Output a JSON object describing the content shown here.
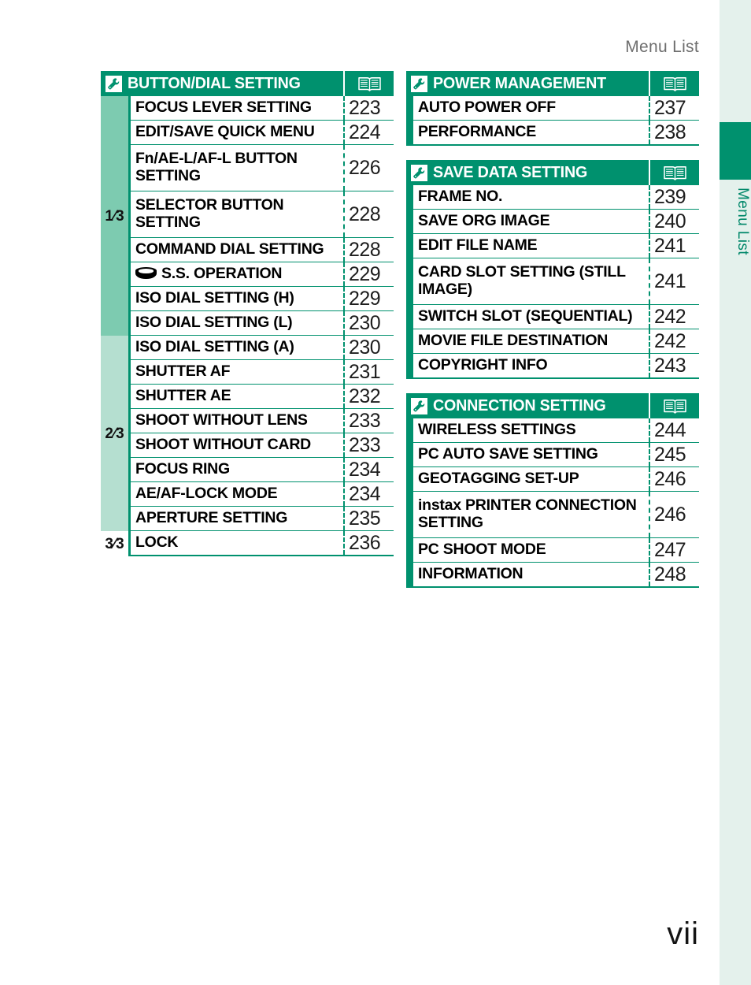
{
  "page": {
    "header_title": "Menu List",
    "page_number": "vii",
    "side_tab_label": "Menu List",
    "accent_green": "#00916e",
    "tab_mint": "#e4f1ec",
    "shade_1_3": "#7dcbb0",
    "shade_2_3": "#b5dfd0",
    "shade_3_3": "#ffffff"
  },
  "icons": {
    "wrench": "wrench-icon",
    "book": "book-icon",
    "dial": "shutter-speed-dial-icon"
  },
  "left_column": {
    "sections": [
      {
        "title": "BUTTON/DIAL SETTING",
        "indicators": [
          {
            "label": "1⁄3",
            "count": 8
          },
          {
            "label": "2⁄3",
            "count": 8
          },
          {
            "label": "3⁄3",
            "count": 1
          }
        ],
        "rows": [
          {
            "label": "FOCUS LEVER SETTING",
            "page": "223"
          },
          {
            "label": "EDIT/SAVE QUICK MENU",
            "page": "224"
          },
          {
            "label": "Fn/AE-L/AF-L BUTTON SETTING",
            "page": "226",
            "two_line": true
          },
          {
            "label": "SELECTOR BUTTON SETTING",
            "page": "228",
            "two_line": true
          },
          {
            "label": "COMMAND DIAL SETTING",
            "page": "228"
          },
          {
            "label": "S.S. OPERATION",
            "page": "229",
            "icon": "dial"
          },
          {
            "label": "ISO DIAL SETTING (H)",
            "page": "229"
          },
          {
            "label": "ISO DIAL SETTING (L)",
            "page": "230"
          },
          {
            "label": "ISO DIAL SETTING (A)",
            "page": "230"
          },
          {
            "label": "SHUTTER AF",
            "page": "231"
          },
          {
            "label": "SHUTTER AE",
            "page": "232"
          },
          {
            "label": "SHOOT WITHOUT LENS",
            "page": "233"
          },
          {
            "label": "SHOOT WITHOUT CARD",
            "page": "233"
          },
          {
            "label": "FOCUS RING",
            "page": "234"
          },
          {
            "label": "AE/AF-LOCK MODE",
            "page": "234"
          },
          {
            "label": "APERTURE SETTING",
            "page": "235"
          },
          {
            "label": "LOCK",
            "page": "236"
          }
        ]
      }
    ]
  },
  "right_column": {
    "sections": [
      {
        "title": "POWER MANAGEMENT",
        "rows": [
          {
            "label": "AUTO POWER OFF",
            "page": "237"
          },
          {
            "label": "PERFORMANCE",
            "page": "238"
          }
        ]
      },
      {
        "title": "SAVE DATA SETTING",
        "rows": [
          {
            "label": "FRAME NO.",
            "page": "239"
          },
          {
            "label": "SAVE ORG IMAGE",
            "page": "240"
          },
          {
            "label": "EDIT FILE NAME",
            "page": "241"
          },
          {
            "label": "CARD SLOT SETTING (STILL IMAGE)",
            "page": "241",
            "two_line": true
          },
          {
            "label": "SWITCH SLOT (SEQUENTIAL)",
            "page": "242"
          },
          {
            "label": "MOVIE FILE DESTINATION",
            "page": "242"
          },
          {
            "label": "COPYRIGHT INFO",
            "page": "243"
          }
        ]
      },
      {
        "title": "CONNECTION SETTING",
        "rows": [
          {
            "label": "WIRELESS SETTINGS",
            "page": "244"
          },
          {
            "label": "PC AUTO SAVE SETTING",
            "page": "245"
          },
          {
            "label": "GEOTAGGING SET-UP",
            "page": "246"
          },
          {
            "label": "instax PRINTER CONNECTION SETTING",
            "page": "246",
            "two_line": true
          },
          {
            "label": "PC SHOOT MODE",
            "page": "247"
          },
          {
            "label": "INFORMATION",
            "page": "248"
          }
        ]
      }
    ]
  }
}
